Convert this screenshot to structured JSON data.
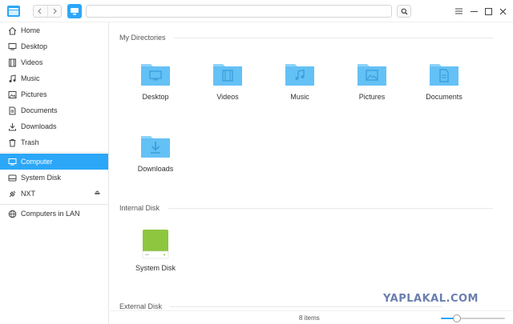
{
  "toolbar": {
    "back_icon": "chevron-left-icon",
    "forward_icon": "chevron-right-icon",
    "address_value": "",
    "search_icon": "search-icon",
    "menu_icon": "menu-icon",
    "minimize_icon": "minimize-icon",
    "maximize_icon": "maximize-icon",
    "close_icon": "close-icon"
  },
  "sidebar": {
    "items": [
      {
        "label": "Home",
        "icon": "home-icon"
      },
      {
        "label": "Desktop",
        "icon": "desktop-icon"
      },
      {
        "label": "Videos",
        "icon": "film-icon"
      },
      {
        "label": "Music",
        "icon": "music-icon"
      },
      {
        "label": "Pictures",
        "icon": "picture-icon"
      },
      {
        "label": "Documents",
        "icon": "document-icon"
      },
      {
        "label": "Downloads",
        "icon": "download-icon"
      },
      {
        "label": "Trash",
        "icon": "trash-icon"
      },
      {
        "label": "Computer",
        "icon": "computer-icon",
        "active": true
      },
      {
        "label": "System Disk",
        "icon": "disk-icon"
      },
      {
        "label": "NXT",
        "icon": "usb-icon",
        "eject": "⏏"
      },
      {
        "label": "Computers in LAN",
        "icon": "network-icon"
      }
    ]
  },
  "main": {
    "sections": {
      "my_directories": "My Directories",
      "internal_disk": "Internal Disk",
      "external_disk": "External Disk"
    },
    "directories": [
      {
        "label": "Desktop",
        "icon": "desktop-folder-icon"
      },
      {
        "label": "Videos",
        "icon": "videos-folder-icon"
      },
      {
        "label": "Music",
        "icon": "music-folder-icon"
      },
      {
        "label": "Pictures",
        "icon": "pictures-folder-icon"
      },
      {
        "label": "Documents",
        "icon": "documents-folder-icon"
      },
      {
        "label": "Downloads",
        "icon": "downloads-folder-icon"
      }
    ],
    "internal_disks": [
      {
        "label": "System Disk",
        "icon": "green-disk-icon"
      }
    ]
  },
  "statusbar": {
    "item_count": "8 items",
    "zoom_level": 0.25
  },
  "colors": {
    "accent": "#2ca7f8",
    "folder": "#64c1f5",
    "folder_tab": "#8fd3fa",
    "disk": "#8dc63f"
  },
  "watermark": "YAPLAKAL.COM"
}
